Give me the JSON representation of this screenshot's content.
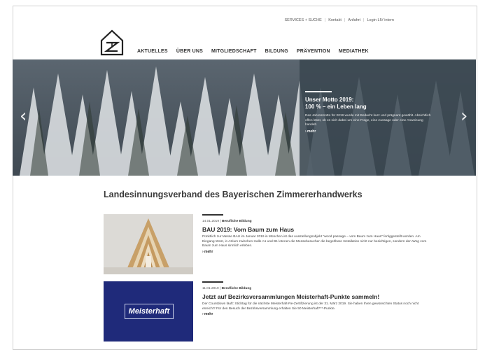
{
  "topbar": {
    "links": [
      "SERVICES + SUCHE",
      "Kontakt",
      "Anfahrt",
      "Login LIV intern"
    ]
  },
  "nav": {
    "items": [
      "AKTUELLES",
      "ÜBER UNS",
      "MITGLIEDSCHAFT",
      "BILDUNG",
      "PRÄVENTION",
      "MEDIATHEK"
    ]
  },
  "hero": {
    "title_line1": "Unser Motto 2019:",
    "title_line2": "100 % – ein Leben lang",
    "text": "Das Jahresmotto für 2019 wurde mit Bedacht kurz und prägnant gewählt. Absichtlich offen lässt, ob es sich dabei um eine Frage, eine Aussage oder eine Anweisung handelt.",
    "more": "› mehr",
    "arrow_left": "‹",
    "arrow_right": "›"
  },
  "page": {
    "title": "Landesinnungsverband des Bayerischen Zimmererhandwerks"
  },
  "news": [
    {
      "date": "14.01.2019",
      "category": "Berufliche Bildung",
      "title": "BAU 2019: Vom Baum zum Haus",
      "text": "Pünktlich zur Messe BAU im Januar 2019 in München ist das Ausstellungsobjekt \"wood passage – vom Baum zum Haus\" fertiggestellt worden. Am Eingang West, in Atrium zwischen Halle A1 und B1 können die Messebesucher die begehbare Installation nicht nur besichtigen, sondern den Weg vom Baum zum Haus sinnlich erleben.",
      "more": "› mehr"
    },
    {
      "date": "11.01.2019",
      "category": "Berufliche Bildung",
      "title": "Jetzt auf Bezirksversammlungen Meisterhaft-Punkte sammeln!",
      "text": "Der Countdown läuft: Stichtag für die nächste Meisterhaft-Re-Zertifizierung ist der 31. März 2019. Sie haben Ihren gewünschten Status noch nicht erreicht? Für den Besuch der Bezirksversammlung erhalten Sie 50 Meisterhaft***-Punkte.",
      "more": "› mehr",
      "logo_text": "Meisterhaft"
    }
  ]
}
